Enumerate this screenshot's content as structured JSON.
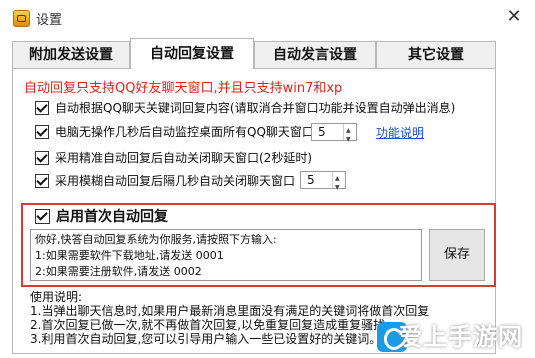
{
  "window": {
    "title": "设置",
    "close_glyph": "✕",
    "app_icon": "app-logo-icon"
  },
  "tabs": [
    {
      "label": "附加发送设置",
      "active": false
    },
    {
      "label": "自动回复设置",
      "active": true
    },
    {
      "label": "自动发言设置",
      "active": false
    },
    {
      "label": "其它设置",
      "active": false
    }
  ],
  "notice": "自动回复只支持QQ好友聊天窗口,并且只支持win7和xp",
  "options": [
    {
      "label": "自动根据QQ聊天关键词回复内容(请取消合并窗口功能并设置自动弹出消息)",
      "checked": true
    },
    {
      "label": "电脑无操作几秒后自动监控桌面所有QQ聊天窗口",
      "checked": true,
      "value": "5",
      "link": "功能说明"
    },
    {
      "label": "采用精准自动回复后自动关闭聊天窗口(2秒延时)",
      "checked": true
    },
    {
      "label": "采用模糊自动回复后隔几秒自动关闭聊天窗口",
      "checked": true,
      "value": "5"
    }
  ],
  "first_reply": {
    "label": "启用首次自动回复",
    "checked": true,
    "lines": [
      "你好,快答自动回复系统为你服务,请按照下方输入:",
      "1:如果需要软件下载地址,请发送 0001",
      "2:如果需要注册软件,请发送 0002"
    ],
    "save_label": "保存"
  },
  "usage": {
    "heading": "使用说明:",
    "lines": [
      "1.当弹出聊天信息时,如果用户最新消息里面没有满足的关键词将做首次回复",
      "2.首次回复已做一次,就不再做首次回复,以免重复回复造成重复骚扰",
      "3.利用首次自动回复,您可以引导用户输入一些已设置好的关键词。"
    ]
  },
  "watermark": {
    "text": "爱上手游网"
  }
}
